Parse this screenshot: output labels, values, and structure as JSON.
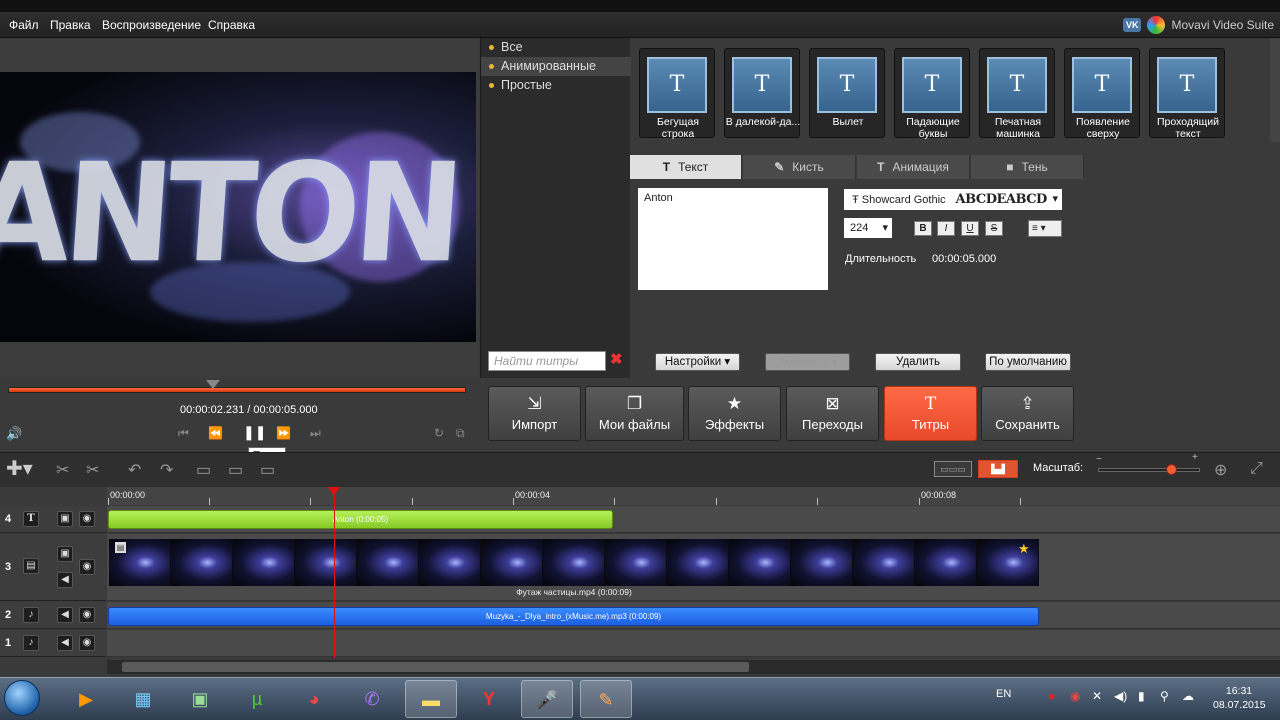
{
  "menu": {
    "items": [
      "Файл",
      "Правка",
      "Воспроизведение",
      "Справка"
    ]
  },
  "brand": {
    "vk": "VK",
    "title": "Movavi Video Suite"
  },
  "preview": {
    "overlay_text": "ANTON"
  },
  "categories": {
    "items": [
      "Все",
      "Анимированные",
      "Простые"
    ],
    "selected": "Анимированные",
    "search_placeholder": "Найти титры",
    "clear_icon": "✖"
  },
  "titles": [
    {
      "icon": "T",
      "label": "Бегущая строка"
    },
    {
      "icon": "T",
      "label": "В далекой-да..."
    },
    {
      "icon": "T",
      "label": "Вылет"
    },
    {
      "icon": "T",
      "label": "Падающие буквы"
    },
    {
      "icon": "T",
      "label": "Печатная машинка"
    },
    {
      "icon": "T",
      "label": "Появление сверху"
    },
    {
      "icon": "T",
      "label": "Проходящий текст"
    }
  ],
  "props": {
    "tabs": [
      {
        "icon": "T",
        "label": "Текст"
      },
      {
        "icon": "✎",
        "label": "Кисть"
      },
      {
        "icon": "T",
        "label": "Анимация"
      },
      {
        "icon": "■",
        "label": "Тень"
      }
    ],
    "text_value": "Anton",
    "font_name": "Showcard Gothic",
    "font_sample": "ABCDEABCD",
    "font_size": "224",
    "format_buttons": [
      "B",
      "I",
      "U",
      "S"
    ],
    "duration_label": "Длительность",
    "duration_value": "00:00:05.000",
    "buttons": {
      "settings": "Настройки",
      "add": "Добавить",
      "delete": "Удалить",
      "default": "По умолчанию"
    }
  },
  "transport": {
    "current": "00:00:02.231",
    "separator": "/",
    "total": "00:00:05.000",
    "progress": 1.0,
    "tooltip": "Пауза"
  },
  "main_buttons": [
    {
      "icon": "⇲",
      "label": "Импорт"
    },
    {
      "icon": "❐",
      "label": "Мои файлы"
    },
    {
      "icon": "★",
      "label": "Эффекты"
    },
    {
      "icon": "⊠",
      "label": "Переходы"
    },
    {
      "icon": "T",
      "label": "Титры"
    },
    {
      "icon": "⇪",
      "label": "Сохранить"
    }
  ],
  "timeline": {
    "scale_label": "Масштаб:",
    "ruler": [
      "00:00:00",
      "00:00:04",
      "00:00:08"
    ],
    "tracks": [
      {
        "num": "4",
        "clip": "Anton (0:00:05)"
      },
      {
        "num": "3",
        "clip": "Футаж частицы.mp4 (0:00:09)"
      },
      {
        "num": "2",
        "clip": "Muzyka_-_Dlya_intro_(xMusic.me).mp3 (0:00:09)"
      },
      {
        "num": "1",
        "clip": ""
      }
    ]
  },
  "taskbar": {
    "lang": "EN",
    "time": "16:31",
    "date": "08.07.2015"
  }
}
